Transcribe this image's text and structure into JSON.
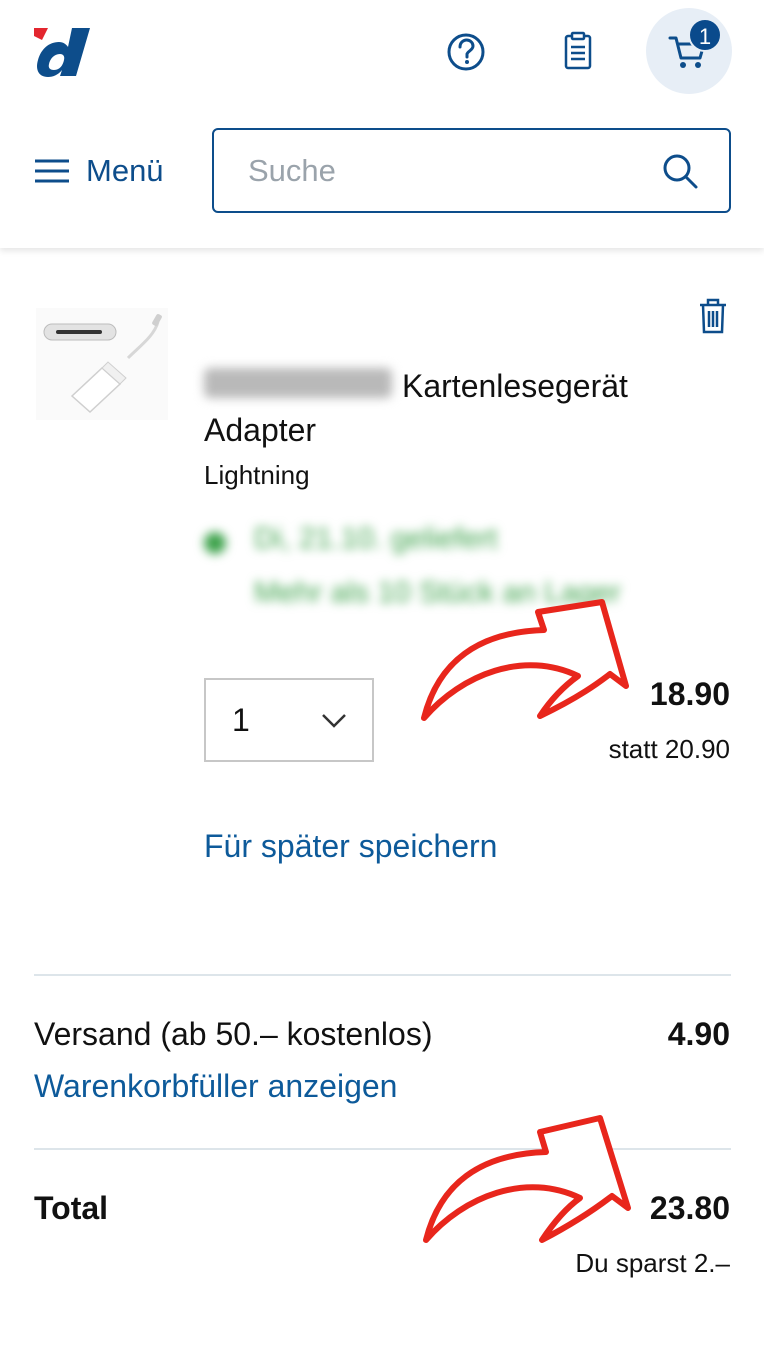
{
  "header": {
    "logo_alt": "d",
    "cart_count": "1",
    "menu_label": "Menü"
  },
  "search": {
    "placeholder": "Suche"
  },
  "cart_item": {
    "title_part1": "Kartenlesegerät",
    "title_part2": "Adapter",
    "variant": "Lightning",
    "availability_line1": "Di, 21.10. geliefert",
    "availability_line2": "Mehr als 10 Stück an Lager",
    "quantity": "1",
    "price": "18.90",
    "old_price": "statt 20.90",
    "save_later": "Für später speichern"
  },
  "summary": {
    "shipping_label": "Versand (ab 50.– kostenlos)",
    "shipping_price": "4.90",
    "filler_link": "Warenkorbfüller anzeigen",
    "total_label": "Total",
    "total_price": "23.80",
    "savings": "Du sparst 2.–"
  },
  "colors": {
    "brand_blue": "#0d4d8b",
    "link_blue": "#0d5a9a",
    "logo_red": "#e3262f",
    "availability_green": "#3da24b",
    "annotation_red": "#e8261c"
  }
}
